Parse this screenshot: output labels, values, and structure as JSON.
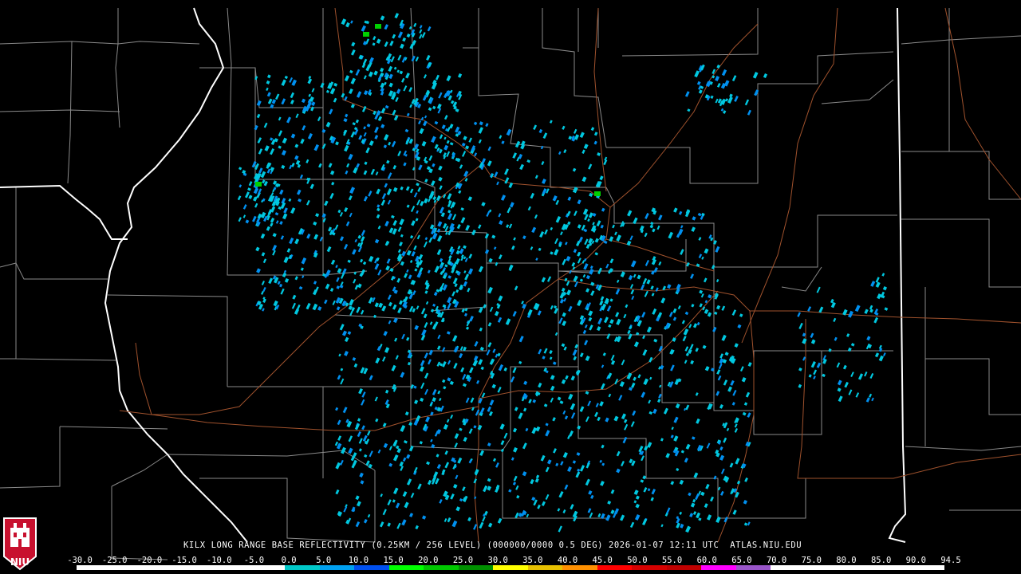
{
  "caption": "KILX LONG RANGE BASE REFLECTIVITY (0.25KM / 256 LEVEL) (000000/0000 0.5 DEG) 2026-01-07 12:11 UTC  ATLAS.NIU.EDU",
  "logo": {
    "text": "NIU",
    "color": "#c8102e"
  },
  "colorbar": {
    "ticks": [
      "-30.0",
      "-25.0",
      "-20.0",
      "-15.0",
      "-10.0",
      "-5.0",
      "0.0",
      "5.0",
      "10.0",
      "15.0",
      "20.0",
      "25.0",
      "30.0",
      "35.0",
      "40.0",
      "45.0",
      "50.0",
      "55.0",
      "60.0",
      "65.0",
      "70.0",
      "75.0",
      "80.0",
      "85.0",
      "90.0",
      "94.5"
    ],
    "colors": [
      "#ffffff",
      "#ffffff",
      "#ffffff",
      "#ffffff",
      "#ffffff",
      "#ffffff",
      "#00c8c8",
      "#00a0f0",
      "#0050f0",
      "#00ff00",
      "#00c800",
      "#009000",
      "#ffff00",
      "#e7c000",
      "#ff9000",
      "#ff0000",
      "#d60000",
      "#c00000",
      "#ff00ff",
      "#9955c9",
      "#ffffff",
      "#ffffff",
      "#ffffff",
      "#ffffff",
      "#ffffff"
    ]
  },
  "map_colors": {
    "background": "#000000",
    "county_lines": "#8a8a8a",
    "state_lines": "#ffffff",
    "highways": "#a0522d",
    "echo_light": "#00c8e0",
    "echo_mid": "#0090f0",
    "echo_strong": "#00d000"
  }
}
